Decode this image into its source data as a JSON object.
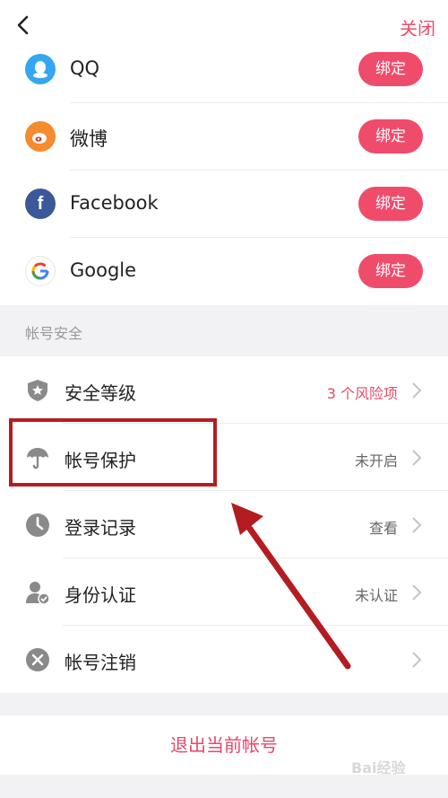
{
  "header": {
    "close_label": "关闭"
  },
  "bindings": [
    {
      "name": "QQ",
      "icon": "qq-icon",
      "color": "#35a7f1",
      "button": "绑定"
    },
    {
      "name": "微博",
      "icon": "weibo-icon",
      "color": "#f58a2e",
      "button": "绑定"
    },
    {
      "name": "Facebook",
      "icon": "facebook-icon",
      "color": "#3b5998",
      "button": "绑定"
    },
    {
      "name": "Google",
      "icon": "google-icon",
      "color": "#ffffff",
      "button": "绑定"
    }
  ],
  "security": {
    "title": "帐号安全",
    "items": [
      {
        "label": "安全等级",
        "value": "3 个风险项",
        "icon": "shield-icon"
      },
      {
        "label": "帐号保护",
        "value": "未开启",
        "icon": "umbrella-icon"
      },
      {
        "label": "登录记录",
        "value": "查看",
        "icon": "clock-icon"
      },
      {
        "label": "身份认证",
        "value": "未认证",
        "icon": "user-verified-icon"
      },
      {
        "label": "帐号注销",
        "value": "",
        "icon": "close-circle-icon"
      }
    ]
  },
  "footer": {
    "logout_label": "退出当前帐号"
  },
  "watermark": {
    "text": "Bai经验"
  },
  "colors": {
    "accent": "#ef4c6c",
    "annotation": "#b31d21"
  }
}
